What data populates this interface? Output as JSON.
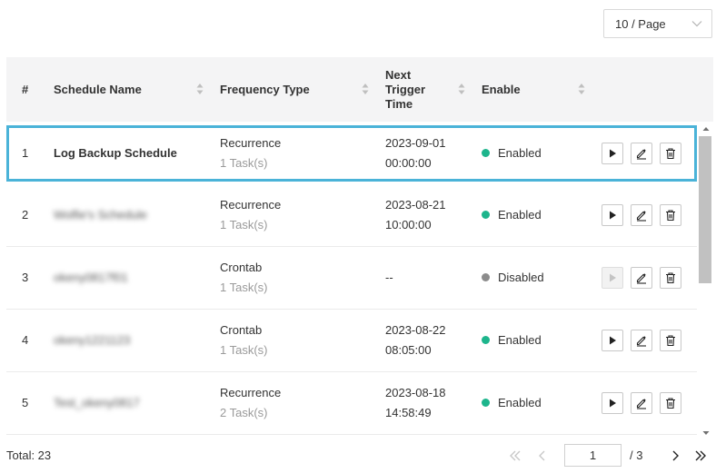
{
  "page_size": {
    "value": "10 / Page"
  },
  "table": {
    "columns": {
      "num": "#",
      "name": "Schedule Name",
      "frequency": "Frequency Type",
      "next_line1": "Next",
      "next_line2": "Trigger",
      "next_line3": "Time",
      "enable": "Enable"
    },
    "rows": [
      {
        "num": "1",
        "name": "Log Backup Schedule",
        "freq": "Recurrence",
        "tasks": "1 Task(s)",
        "date": "2023-09-01",
        "time": "00:00:00",
        "status": "Enabled"
      },
      {
        "num": "2",
        "name": "Wolfie's Schedule",
        "freq": "Recurrence",
        "tasks": "1 Task(s)",
        "date": "2023-08-21",
        "time": "10:00:00",
        "status": "Enabled"
      },
      {
        "num": "3",
        "name": "okeny0817f01",
        "freq": "Crontab",
        "tasks": "1 Task(s)",
        "date": "--",
        "time": "",
        "status": "Disabled"
      },
      {
        "num": "4",
        "name": "okeny1221123",
        "freq": "Crontab",
        "tasks": "1 Task(s)",
        "date": "2023-08-22",
        "time": "08:05:00",
        "status": "Enabled"
      },
      {
        "num": "5",
        "name": "Test_okeny0817",
        "freq": "Recurrence",
        "tasks": "2 Task(s)",
        "date": "2023-08-18",
        "time": "14:58:49",
        "status": "Enabled"
      }
    ]
  },
  "footer": {
    "total": "Total: 23",
    "current_page": "1",
    "page_of": "/ 3"
  },
  "colors": {
    "enabled": "#1db58c",
    "disabled": "#8c8c8c",
    "selected_outline": "#4ab3d8",
    "header_bg": "#f4f4f5"
  },
  "icons": [
    "chevron-down-icon",
    "sort-icon",
    "play-icon",
    "edit-icon",
    "delete-icon",
    "first-page-icon",
    "prev-page-icon",
    "next-page-icon",
    "last-page-icon"
  ]
}
